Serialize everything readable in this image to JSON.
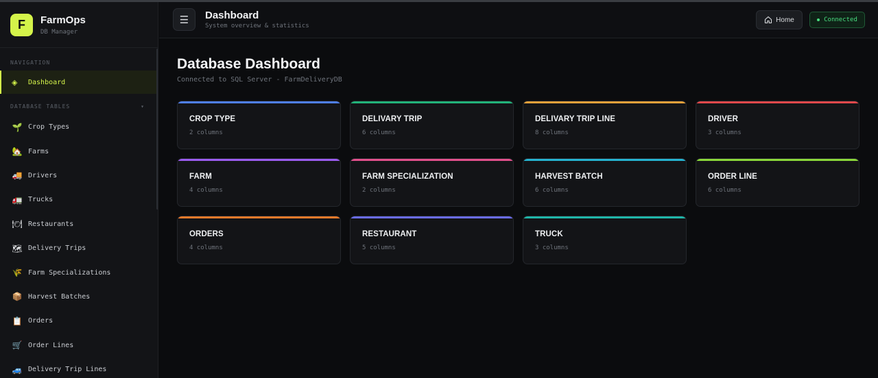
{
  "brand": {
    "logo_letter": "F",
    "name": "FarmOps",
    "subtitle": "DB Manager",
    "accent": "#d4f34a"
  },
  "sidebar": {
    "navigation_label": "NAVIGATION",
    "active_item": {
      "icon": "diamond-icon",
      "glyph": "◈",
      "label": "Dashboard"
    },
    "tables_label": "DATABASE TABLES",
    "tables_caret": "▾",
    "items": [
      {
        "icon": "seedling-icon",
        "glyph": "🌱",
        "label": "Crop Types"
      },
      {
        "icon": "farm-house-icon",
        "glyph": "🏡",
        "label": "Farms"
      },
      {
        "icon": "delivery-truck-icon",
        "glyph": "🚚",
        "label": "Drivers"
      },
      {
        "icon": "truck-icon",
        "glyph": "🚛",
        "label": "Trucks"
      },
      {
        "icon": "plate-icon",
        "glyph": "🍽",
        "label": "Restaurants"
      },
      {
        "icon": "map-icon",
        "glyph": "🗺",
        "label": "Delivery Trips"
      },
      {
        "icon": "farmer-icon",
        "glyph": "🌾",
        "label": "Farm Specializations"
      },
      {
        "icon": "package-icon",
        "glyph": "📦",
        "label": "Harvest Batches"
      },
      {
        "icon": "clipboard-icon",
        "glyph": "📋",
        "label": "Orders"
      },
      {
        "icon": "cart-icon",
        "glyph": "🛒",
        "label": "Order Lines"
      },
      {
        "icon": "car-icon",
        "glyph": "🚙",
        "label": "Delivery Trip Lines"
      }
    ]
  },
  "header": {
    "menu_glyph": "☰",
    "title": "Dashboard",
    "subtitle": "System overview & statistics",
    "home_label": "Home",
    "status_label": "Connected",
    "status_color": "#4ade80"
  },
  "main": {
    "title": "Database Dashboard",
    "subtitle": "Connected to SQL Server - FarmDeliveryDB",
    "cards": [
      {
        "title": "CROP TYPE",
        "columns": "2 columns",
        "color": "#4f7ff0"
      },
      {
        "title": "DELIVARY TRIP",
        "columns": "6 columns",
        "color": "#22b37a"
      },
      {
        "title": "DELIVARY TRIP LINE",
        "columns": "8 columns",
        "color": "#e8a13a"
      },
      {
        "title": "DRIVER",
        "columns": "3 columns",
        "color": "#e0484b"
      },
      {
        "title": "FARM",
        "columns": "4 columns",
        "color": "#9b5cf0"
      },
      {
        "title": "FARM SPECIALIZATION",
        "columns": "2 columns",
        "color": "#e2508c"
      },
      {
        "title": "HARVEST BATCH",
        "columns": "6 columns",
        "color": "#25b3d0"
      },
      {
        "title": "ORDER LINE",
        "columns": "6 columns",
        "color": "#8bd83a"
      },
      {
        "title": "ORDERS",
        "columns": "4 columns",
        "color": "#f07a2a"
      },
      {
        "title": "RESTAURANT",
        "columns": "5 columns",
        "color": "#6a6cf0"
      },
      {
        "title": "TRUCK",
        "columns": "3 columns",
        "color": "#1fb5a8"
      }
    ]
  }
}
